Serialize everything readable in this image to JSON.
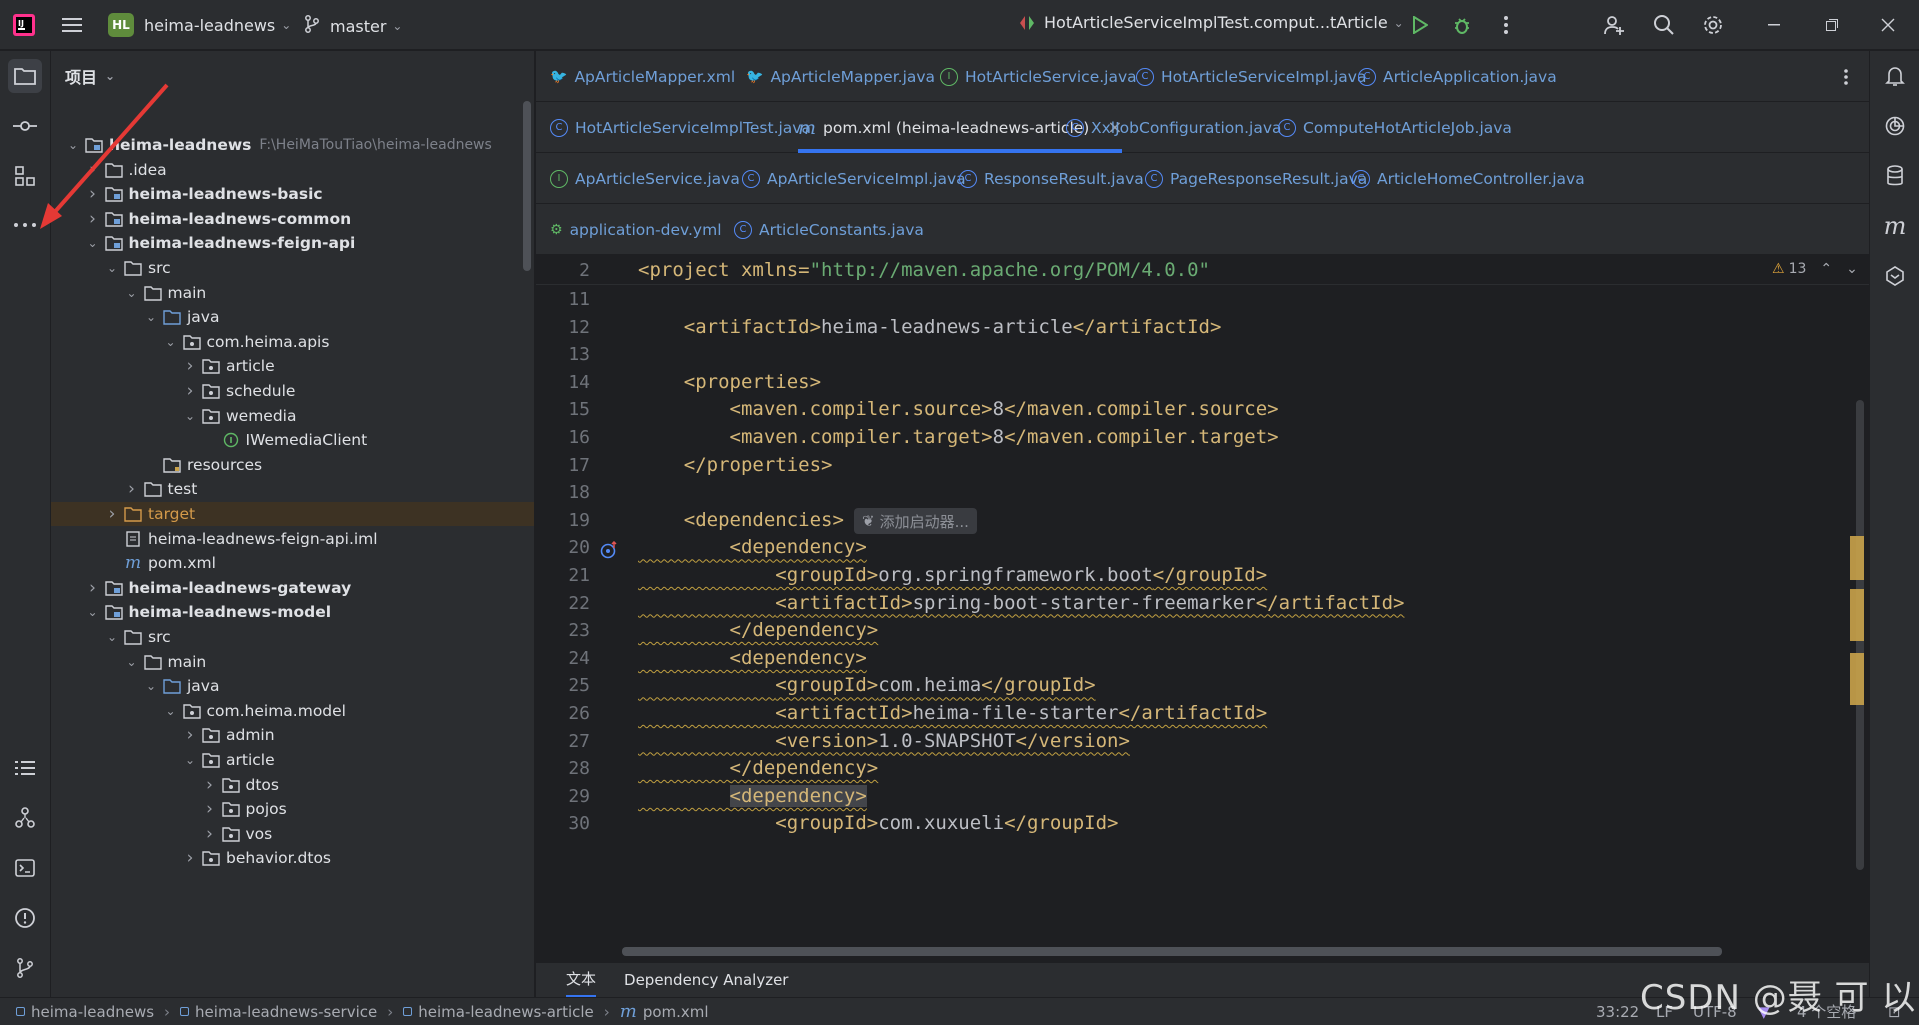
{
  "titlebar": {
    "project_badge": "HL",
    "project_name": "heima-leadnews",
    "branch": "master",
    "run_config": "HotArticleServiceImplTest.comput...tArticle"
  },
  "project_panel": {
    "title": "项目",
    "tree": [
      {
        "label": "heima-leadnews",
        "path": "F:\\HeiMaTouTiao\\heima-leadnews",
        "depth": 0,
        "arrow": "down",
        "icon": "module",
        "bold": true
      },
      {
        "label": ".idea",
        "depth": 1,
        "arrow": "right",
        "icon": "folder"
      },
      {
        "label": "heima-leadnews-basic",
        "depth": 1,
        "arrow": "right",
        "icon": "module",
        "bold": true
      },
      {
        "label": "heima-leadnews-common",
        "depth": 1,
        "arrow": "right",
        "icon": "module",
        "bold": true
      },
      {
        "label": "heima-leadnews-feign-api",
        "depth": 1,
        "arrow": "down",
        "icon": "module",
        "bold": true
      },
      {
        "label": "src",
        "depth": 2,
        "arrow": "down",
        "icon": "folder"
      },
      {
        "label": "main",
        "depth": 3,
        "arrow": "down",
        "icon": "folder"
      },
      {
        "label": "java",
        "depth": 4,
        "arrow": "down",
        "icon": "folder-blue"
      },
      {
        "label": "com.heima.apis",
        "depth": 5,
        "arrow": "down",
        "icon": "package"
      },
      {
        "label": "article",
        "depth": 6,
        "arrow": "right",
        "icon": "package"
      },
      {
        "label": "schedule",
        "depth": 6,
        "arrow": "right",
        "icon": "package"
      },
      {
        "label": "wemedia",
        "depth": 6,
        "arrow": "down",
        "icon": "package"
      },
      {
        "label": "IWemediaClient",
        "depth": 7,
        "arrow": "",
        "icon": "interface"
      },
      {
        "label": "resources",
        "depth": 4,
        "arrow": "",
        "icon": "folder-res"
      },
      {
        "label": "test",
        "depth": 3,
        "arrow": "right",
        "icon": "folder"
      },
      {
        "label": "target",
        "depth": 2,
        "arrow": "right",
        "icon": "folder-orange",
        "highlight": true
      },
      {
        "label": "heima-leadnews-feign-api.iml",
        "depth": 2,
        "arrow": "",
        "icon": "file"
      },
      {
        "label": "pom.xml",
        "depth": 2,
        "arrow": "",
        "icon": "maven"
      },
      {
        "label": "heima-leadnews-gateway",
        "depth": 1,
        "arrow": "right",
        "icon": "module",
        "bold": true
      },
      {
        "label": "heima-leadnews-model",
        "depth": 1,
        "arrow": "down",
        "icon": "module",
        "bold": true
      },
      {
        "label": "src",
        "depth": 2,
        "arrow": "down",
        "icon": "folder"
      },
      {
        "label": "main",
        "depth": 3,
        "arrow": "down",
        "icon": "folder"
      },
      {
        "label": "java",
        "depth": 4,
        "arrow": "down",
        "icon": "folder-blue"
      },
      {
        "label": "com.heima.model",
        "depth": 5,
        "arrow": "down",
        "icon": "package"
      },
      {
        "label": "admin",
        "depth": 6,
        "arrow": "right",
        "icon": "package"
      },
      {
        "label": "article",
        "depth": 6,
        "arrow": "down",
        "icon": "package"
      },
      {
        "label": "dtos",
        "depth": 7,
        "arrow": "right",
        "icon": "package"
      },
      {
        "label": "pojos",
        "depth": 7,
        "arrow": "right",
        "icon": "package"
      },
      {
        "label": "vos",
        "depth": 7,
        "arrow": "right",
        "icon": "package"
      },
      {
        "label": "behavior.dtos",
        "depth": 6,
        "arrow": "right",
        "icon": "package"
      }
    ]
  },
  "tabs": {
    "row1": [
      {
        "label": "ApArticleMapper.xml",
        "icon": "mybatis"
      },
      {
        "label": "ApArticleMapper.java",
        "icon": "mybatis"
      },
      {
        "label": "HotArticleService.java",
        "icon": "interface"
      },
      {
        "label": "HotArticleServiceImpl.java",
        "icon": "class"
      },
      {
        "label": "ArticleApplication.java",
        "icon": "class-run"
      }
    ],
    "row2": [
      {
        "label": "HotArticleServiceImplTest.java",
        "icon": "class-test"
      },
      {
        "label": "pom.xml (heima-leadnews-article)",
        "icon": "maven",
        "active": true
      },
      {
        "label": "XxlJobConfiguration.java",
        "icon": "class"
      },
      {
        "label": "ComputeHotArticleJob.java",
        "icon": "class"
      }
    ],
    "row3": [
      {
        "label": "ApArticleService.java",
        "icon": "interface"
      },
      {
        "label": "ApArticleServiceImpl.java",
        "icon": "class"
      },
      {
        "label": "ResponseResult.java",
        "icon": "class"
      },
      {
        "label": "PageResponseResult.java",
        "icon": "class"
      },
      {
        "label": "ArticleHomeController.java",
        "icon": "class"
      }
    ],
    "row4": [
      {
        "label": "application-dev.yml",
        "icon": "yml"
      },
      {
        "label": "ArticleConstants.java",
        "icon": "class"
      }
    ]
  },
  "editor": {
    "warning_count": "13",
    "sticky_line": {
      "num": "2",
      "text_open": "<project xmlns=",
      "text_str": "\"http://maven.apache.org/POM/4.0.0\""
    },
    "lines": [
      {
        "num": "11",
        "code": ""
      },
      {
        "num": "12",
        "code": "    <artifactId>heima-leadnews-article</artifactId>"
      },
      {
        "num": "13",
        "code": ""
      },
      {
        "num": "14",
        "code": "    <properties>"
      },
      {
        "num": "15",
        "code": "        <maven.compiler.source>8</maven.compiler.source>"
      },
      {
        "num": "16",
        "code": "        <maven.compiler.target>8</maven.compiler.target>"
      },
      {
        "num": "17",
        "code": "    </properties>"
      },
      {
        "num": "18",
        "code": ""
      },
      {
        "num": "19",
        "code": "    <dependencies>"
      },
      {
        "num": "20",
        "code": "        <dependency>"
      },
      {
        "num": "21",
        "code": "            <groupId>org.springframework.boot</groupId>"
      },
      {
        "num": "22",
        "code": "            <artifactId>spring-boot-starter-freemarker</artifactId>"
      },
      {
        "num": "23",
        "code": "        </dependency>"
      },
      {
        "num": "24",
        "code": "        <dependency>"
      },
      {
        "num": "25",
        "code": "            <groupId>com.heima</groupId>"
      },
      {
        "num": "26",
        "code": "            <artifactId>heima-file-starter</artifactId>"
      },
      {
        "num": "27",
        "code": "            <version>1.0-SNAPSHOT</version>"
      },
      {
        "num": "28",
        "code": "        </dependency>"
      },
      {
        "num": "29",
        "code": "        <dependency>"
      },
      {
        "num": "30",
        "code": "            <groupId>com.xuxueli</groupId>"
      }
    ],
    "inlay_hint": "添加启动器..."
  },
  "bottom_tabs": [
    "文本",
    "Dependency Analyzer"
  ],
  "statusbar": {
    "breadcrumbs": [
      "heima-leadnews",
      "heima-leadnews-service",
      "heima-leadnews-article",
      "pom.xml"
    ],
    "position": "33:22",
    "line_sep": "LF",
    "encoding": "UTF-8",
    "indent": "4 个空格"
  },
  "watermark": "CSDN @聂 可 以",
  "colors": {
    "accent": "#3574f0",
    "annotation_arrow": "#e53935",
    "tag": "#d5b778",
    "string": "#6aab73"
  }
}
